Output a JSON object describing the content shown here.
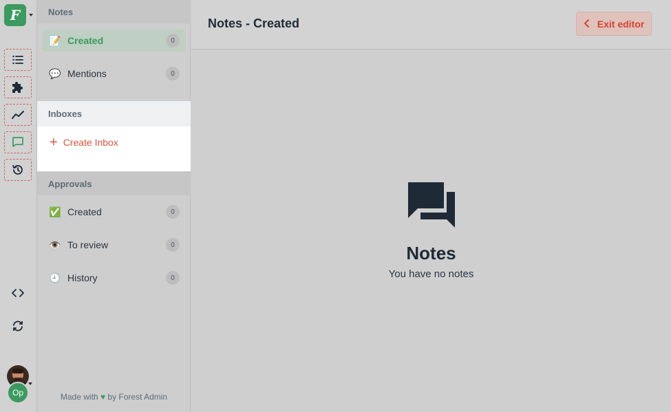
{
  "rail": {
    "logo_letter": "F",
    "user_initials": "Op",
    "icons": [
      "list-icon",
      "puzzle-icon",
      "chart-line-icon",
      "chat-icon",
      "history-icon",
      "code-icon",
      "sync-icon"
    ]
  },
  "sidebar": {
    "notes_header": "Notes",
    "notes_items": [
      {
        "label": "Created",
        "count": "0",
        "emoji": "📝"
      },
      {
        "label": "Mentions",
        "count": "0",
        "emoji": "💬"
      }
    ],
    "inboxes_header": "Inboxes",
    "create_inbox_label": "Create Inbox",
    "approvals_header": "Approvals",
    "approvals_items": [
      {
        "label": "Created",
        "count": "0",
        "emoji": "✅"
      },
      {
        "label": "To review",
        "count": "0",
        "emoji": "👁️"
      },
      {
        "label": "History",
        "count": "0",
        "emoji": "🕘"
      }
    ],
    "footer_prefix": "Made with",
    "footer_suffix": "by Forest Admin"
  },
  "main": {
    "title": "Notes - Created",
    "exit_label": "Exit editor",
    "empty_title": "Notes",
    "empty_subtitle": "You have no notes"
  },
  "colors": {
    "accent_green": "#3b9a5f",
    "accent_red": "#e0533c"
  }
}
